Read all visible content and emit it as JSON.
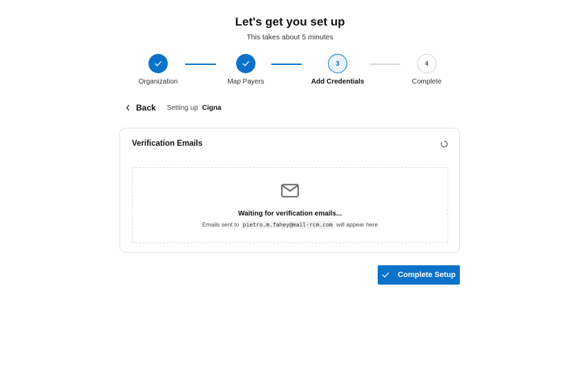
{
  "header": {
    "title": "Let's get you set up",
    "subtitle": "This takes about 5 minutes"
  },
  "steps": [
    {
      "label": "Organization",
      "state": "complete",
      "number": ""
    },
    {
      "label": "Map Payers",
      "state": "complete",
      "number": ""
    },
    {
      "label": "Add Credentials",
      "state": "current",
      "number": "3"
    },
    {
      "label": "Complete",
      "state": "upcoming",
      "number": "4"
    }
  ],
  "nav": {
    "back_label": "Back",
    "setting_up_label": "Setting up",
    "payer_name": "Cigna"
  },
  "verification": {
    "title": "Verification Emails",
    "waiting_text": "Waiting for verification emails...",
    "sent_prefix": "Emails sent to",
    "email": "pietro.m.fahey@mail-rcm.com",
    "sent_suffix": "will appear here"
  },
  "actions": {
    "complete_label": "Complete Setup"
  },
  "icons": {
    "step_done": "check-icon",
    "back": "chevron-left-icon",
    "loading": "spinner-icon",
    "empty_state": "mail-icon",
    "complete": "check-icon"
  },
  "colors": {
    "primary": "#0b72c9",
    "current_step_bg": "#e8f2fb",
    "inactive_line": "#d9d9d9"
  }
}
